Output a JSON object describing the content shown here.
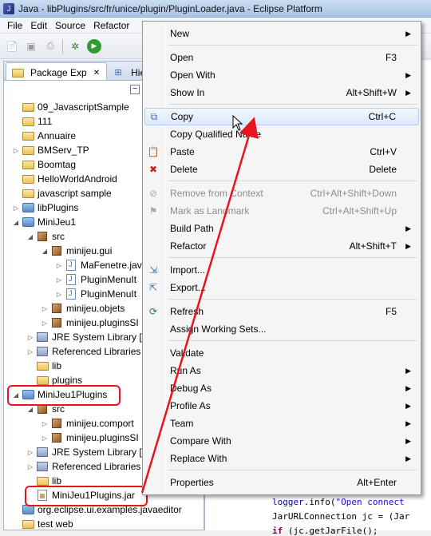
{
  "window": {
    "title": "Java - libPlugins/src/fr/unice/plugin/PluginLoader.java - Eclipse Platform"
  },
  "menubar": [
    "File",
    "Edit",
    "Source",
    "Refactor"
  ],
  "view": {
    "tabs": [
      "Package Exp",
      "Hier"
    ]
  },
  "tree": [
    {
      "label": "09_JavascriptSample",
      "type": "folder",
      "indent": 0,
      "exp": ""
    },
    {
      "label": "111",
      "type": "folder",
      "indent": 0,
      "exp": ""
    },
    {
      "label": "Annuaire",
      "type": "folder",
      "indent": 0,
      "exp": ""
    },
    {
      "label": "BMServ_TP",
      "type": "folder",
      "indent": 0,
      "exp": "▷"
    },
    {
      "label": "Boomtag",
      "type": "folder",
      "indent": 0,
      "exp": ""
    },
    {
      "label": "HelloWorldAndroid",
      "type": "folder",
      "indent": 0,
      "exp": ""
    },
    {
      "label": "javascript sample",
      "type": "folder",
      "indent": 0,
      "exp": ""
    },
    {
      "label": "libPlugins",
      "type": "project",
      "indent": 0,
      "exp": "▷"
    },
    {
      "label": "MiniJeu1",
      "type": "project",
      "indent": 0,
      "exp": "◢"
    },
    {
      "label": "src",
      "type": "srcfolder",
      "indent": 1,
      "exp": "◢"
    },
    {
      "label": "minijeu.gui",
      "type": "package",
      "indent": 2,
      "exp": "◢"
    },
    {
      "label": "MaFenetre.jav",
      "type": "java",
      "indent": 3,
      "exp": "▷"
    },
    {
      "label": "PluginMenuIt",
      "type": "java",
      "indent": 3,
      "exp": "▷"
    },
    {
      "label": "PluginMenuIt",
      "type": "java",
      "indent": 3,
      "exp": "▷"
    },
    {
      "label": "minijeu.objets",
      "type": "package",
      "indent": 2,
      "exp": "▷"
    },
    {
      "label": "minijeu.pluginsSI",
      "type": "package",
      "indent": 2,
      "exp": "▷"
    },
    {
      "label": "JRE System Library [j",
      "type": "lib",
      "indent": 1,
      "exp": "▷"
    },
    {
      "label": "Referenced Libraries",
      "type": "lib",
      "indent": 1,
      "exp": "▷"
    },
    {
      "label": "lib",
      "type": "folder",
      "indent": 1,
      "exp": ""
    },
    {
      "label": "plugins",
      "type": "folder",
      "indent": 1,
      "exp": ""
    },
    {
      "label": "MiniJeu1Plugins",
      "type": "project",
      "indent": 0,
      "exp": "◢"
    },
    {
      "label": "src",
      "type": "srcfolder",
      "indent": 1,
      "exp": "◢"
    },
    {
      "label": "minijeu.comport",
      "type": "package",
      "indent": 2,
      "exp": "▷"
    },
    {
      "label": "minijeu.pluginsSI",
      "type": "package",
      "indent": 2,
      "exp": "▷"
    },
    {
      "label": "JRE System Library [j",
      "type": "lib",
      "indent": 1,
      "exp": "▷"
    },
    {
      "label": "Referenced Libraries",
      "type": "lib",
      "indent": 1,
      "exp": "▷"
    },
    {
      "label": "lib",
      "type": "folder",
      "indent": 1,
      "exp": ""
    },
    {
      "label": "MiniJeu1Plugins.jar",
      "type": "jar",
      "indent": 1,
      "exp": ""
    },
    {
      "label": "org.eclipse.ui.examples.javaeditor",
      "type": "project",
      "indent": 0,
      "exp": ""
    },
    {
      "label": "test web",
      "type": "folder",
      "indent": 0,
      "exp": ""
    }
  ],
  "context_menu": [
    {
      "label": "New",
      "shortcut": "",
      "submenu": true,
      "icon": ""
    },
    {
      "sep": true
    },
    {
      "label": "Open",
      "shortcut": "F3",
      "icon": ""
    },
    {
      "label": "Open With",
      "shortcut": "",
      "submenu": true,
      "icon": ""
    },
    {
      "label": "Show In",
      "shortcut": "Alt+Shift+W",
      "submenu": true,
      "icon": ""
    },
    {
      "sep": true
    },
    {
      "label": "Copy",
      "shortcut": "Ctrl+C",
      "icon": "copy-icon",
      "hover": true
    },
    {
      "label": "Copy Qualified Name",
      "shortcut": "",
      "icon": ""
    },
    {
      "label": "Paste",
      "shortcut": "Ctrl+V",
      "icon": "paste-icon"
    },
    {
      "label": "Delete",
      "shortcut": "Delete",
      "icon": "delete-icon"
    },
    {
      "sep": true
    },
    {
      "label": "Remove from Context",
      "shortcut": "Ctrl+Alt+Shift+Down",
      "icon": "remove-context-icon",
      "disabled": true
    },
    {
      "label": "Mark as Landmark",
      "shortcut": "Ctrl+Alt+Shift+Up",
      "icon": "landmark-icon",
      "disabled": true
    },
    {
      "label": "Build Path",
      "shortcut": "",
      "submenu": true,
      "icon": ""
    },
    {
      "label": "Refactor",
      "shortcut": "Alt+Shift+T",
      "submenu": true,
      "icon": ""
    },
    {
      "sep": true
    },
    {
      "label": "Import...",
      "shortcut": "",
      "icon": "import-icon"
    },
    {
      "label": "Export...",
      "shortcut": "",
      "icon": "export-icon"
    },
    {
      "sep": true
    },
    {
      "label": "Refresh",
      "shortcut": "F5",
      "icon": "refresh-icon"
    },
    {
      "label": "Assign Working Sets...",
      "shortcut": "",
      "icon": ""
    },
    {
      "sep": true
    },
    {
      "label": "Validate",
      "shortcut": "",
      "icon": ""
    },
    {
      "label": "Run As",
      "shortcut": "",
      "submenu": true,
      "icon": ""
    },
    {
      "label": "Debug As",
      "shortcut": "",
      "submenu": true,
      "icon": ""
    },
    {
      "label": "Profile As",
      "shortcut": "",
      "submenu": true,
      "icon": ""
    },
    {
      "label": "Team",
      "shortcut": "",
      "submenu": true,
      "icon": ""
    },
    {
      "label": "Compare With",
      "shortcut": "",
      "submenu": true,
      "icon": ""
    },
    {
      "label": "Replace With",
      "shortcut": "",
      "submenu": true,
      "icon": ""
    },
    {
      "sep": true
    },
    {
      "label": "Properties",
      "shortcut": "Alt+Enter",
      "icon": ""
    }
  ],
  "editor": {
    "lines": [
      {
        "pre": "",
        "field": "logger",
        "post": ".info(",
        "str": "\"Open connect",
        "kw": ""
      },
      {
        "pre": "JarURLConnection jc = (Jar",
        "field": "",
        "post": "",
        "str": "",
        "kw": ""
      },
      {
        "pre": "",
        "field": "",
        "post": " (jc.getJarFile();",
        "str": "",
        "kw": "if"
      }
    ]
  },
  "colors": {
    "highlight": "#e8141f",
    "menu_hover": "#dbe9f9"
  }
}
